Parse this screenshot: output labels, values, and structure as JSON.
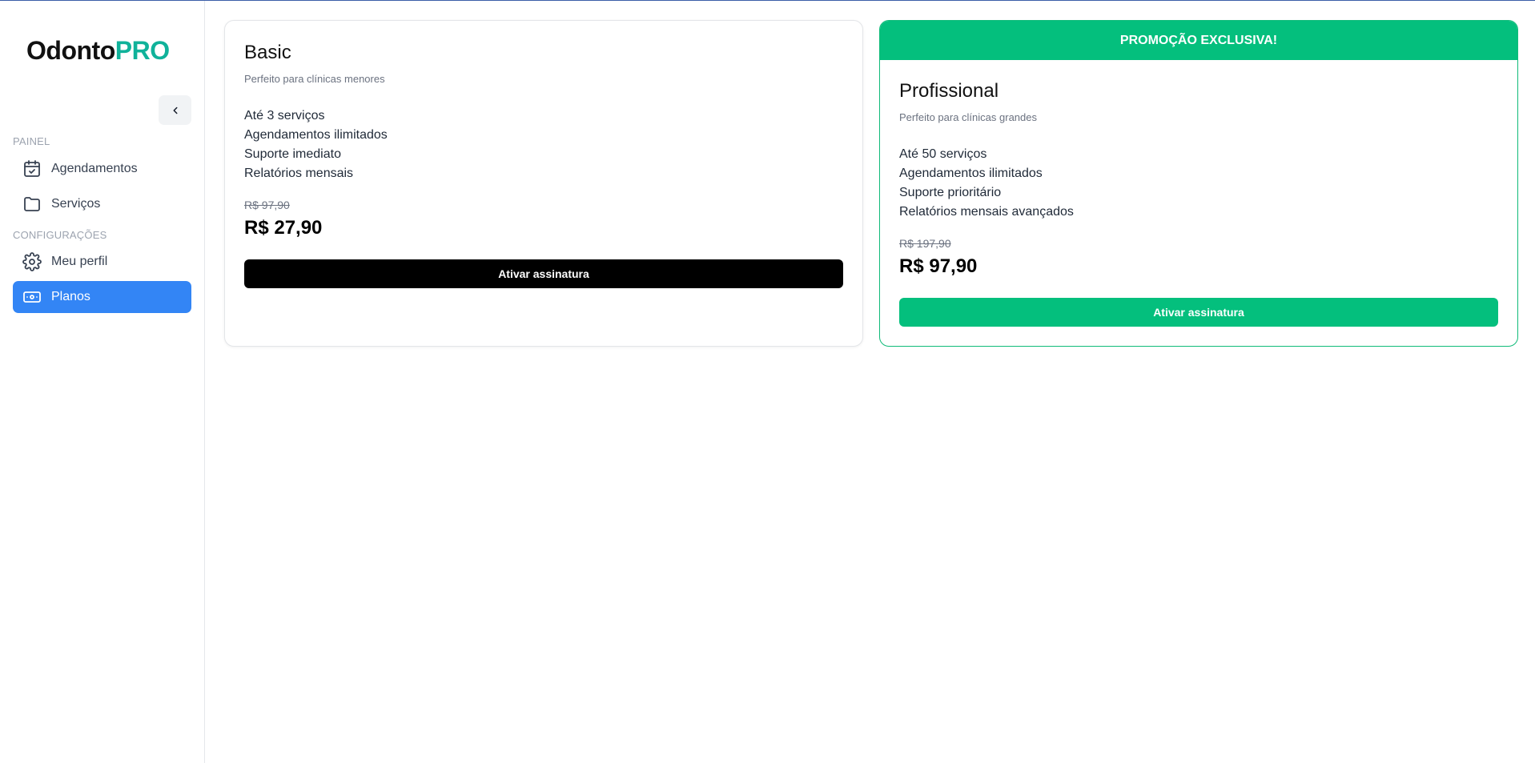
{
  "app": {
    "logo_primary": "Odonto",
    "logo_accent": "PRO",
    "accent_color": "#10b29a"
  },
  "sidebar": {
    "collapse_icon": "chevron-left-icon",
    "sections": [
      {
        "label": "PAINEL"
      },
      {
        "label": "CONFIGURAÇÕES"
      }
    ],
    "items": [
      {
        "label": "Agendamentos",
        "icon": "calendar-check-icon"
      },
      {
        "label": "Serviços",
        "icon": "folder-icon"
      },
      {
        "label": "Meu perfil",
        "icon": "gear-icon"
      },
      {
        "label": "Planos",
        "icon": "banknote-icon",
        "active": true
      }
    ],
    "active_color": "#3385f5"
  },
  "plans": [
    {
      "title": "Basic",
      "subtitle": "Perfeito para clínicas menores",
      "features": [
        "Até 3 serviços",
        "Agendamentos ilimitados",
        "Suporte imediato",
        "Relatórios mensais"
      ],
      "old_price": "R$ 97,90",
      "price": "R$ 27,90",
      "cta": "Ativar assinatura",
      "cta_color": "#000000"
    },
    {
      "banner": "PROMOÇÃO EXCLUSIVA!",
      "title": "Profissional",
      "subtitle": "Perfeito para clínicas grandes",
      "features": [
        "Até 50 serviços",
        "Agendamentos ilimitados",
        "Suporte prioritário",
        "Relatórios mensais avançados"
      ],
      "old_price": "R$ 197,90",
      "price": "R$ 97,90",
      "cta": "Ativar assinatura",
      "cta_color": "#04bf7d"
    }
  ]
}
